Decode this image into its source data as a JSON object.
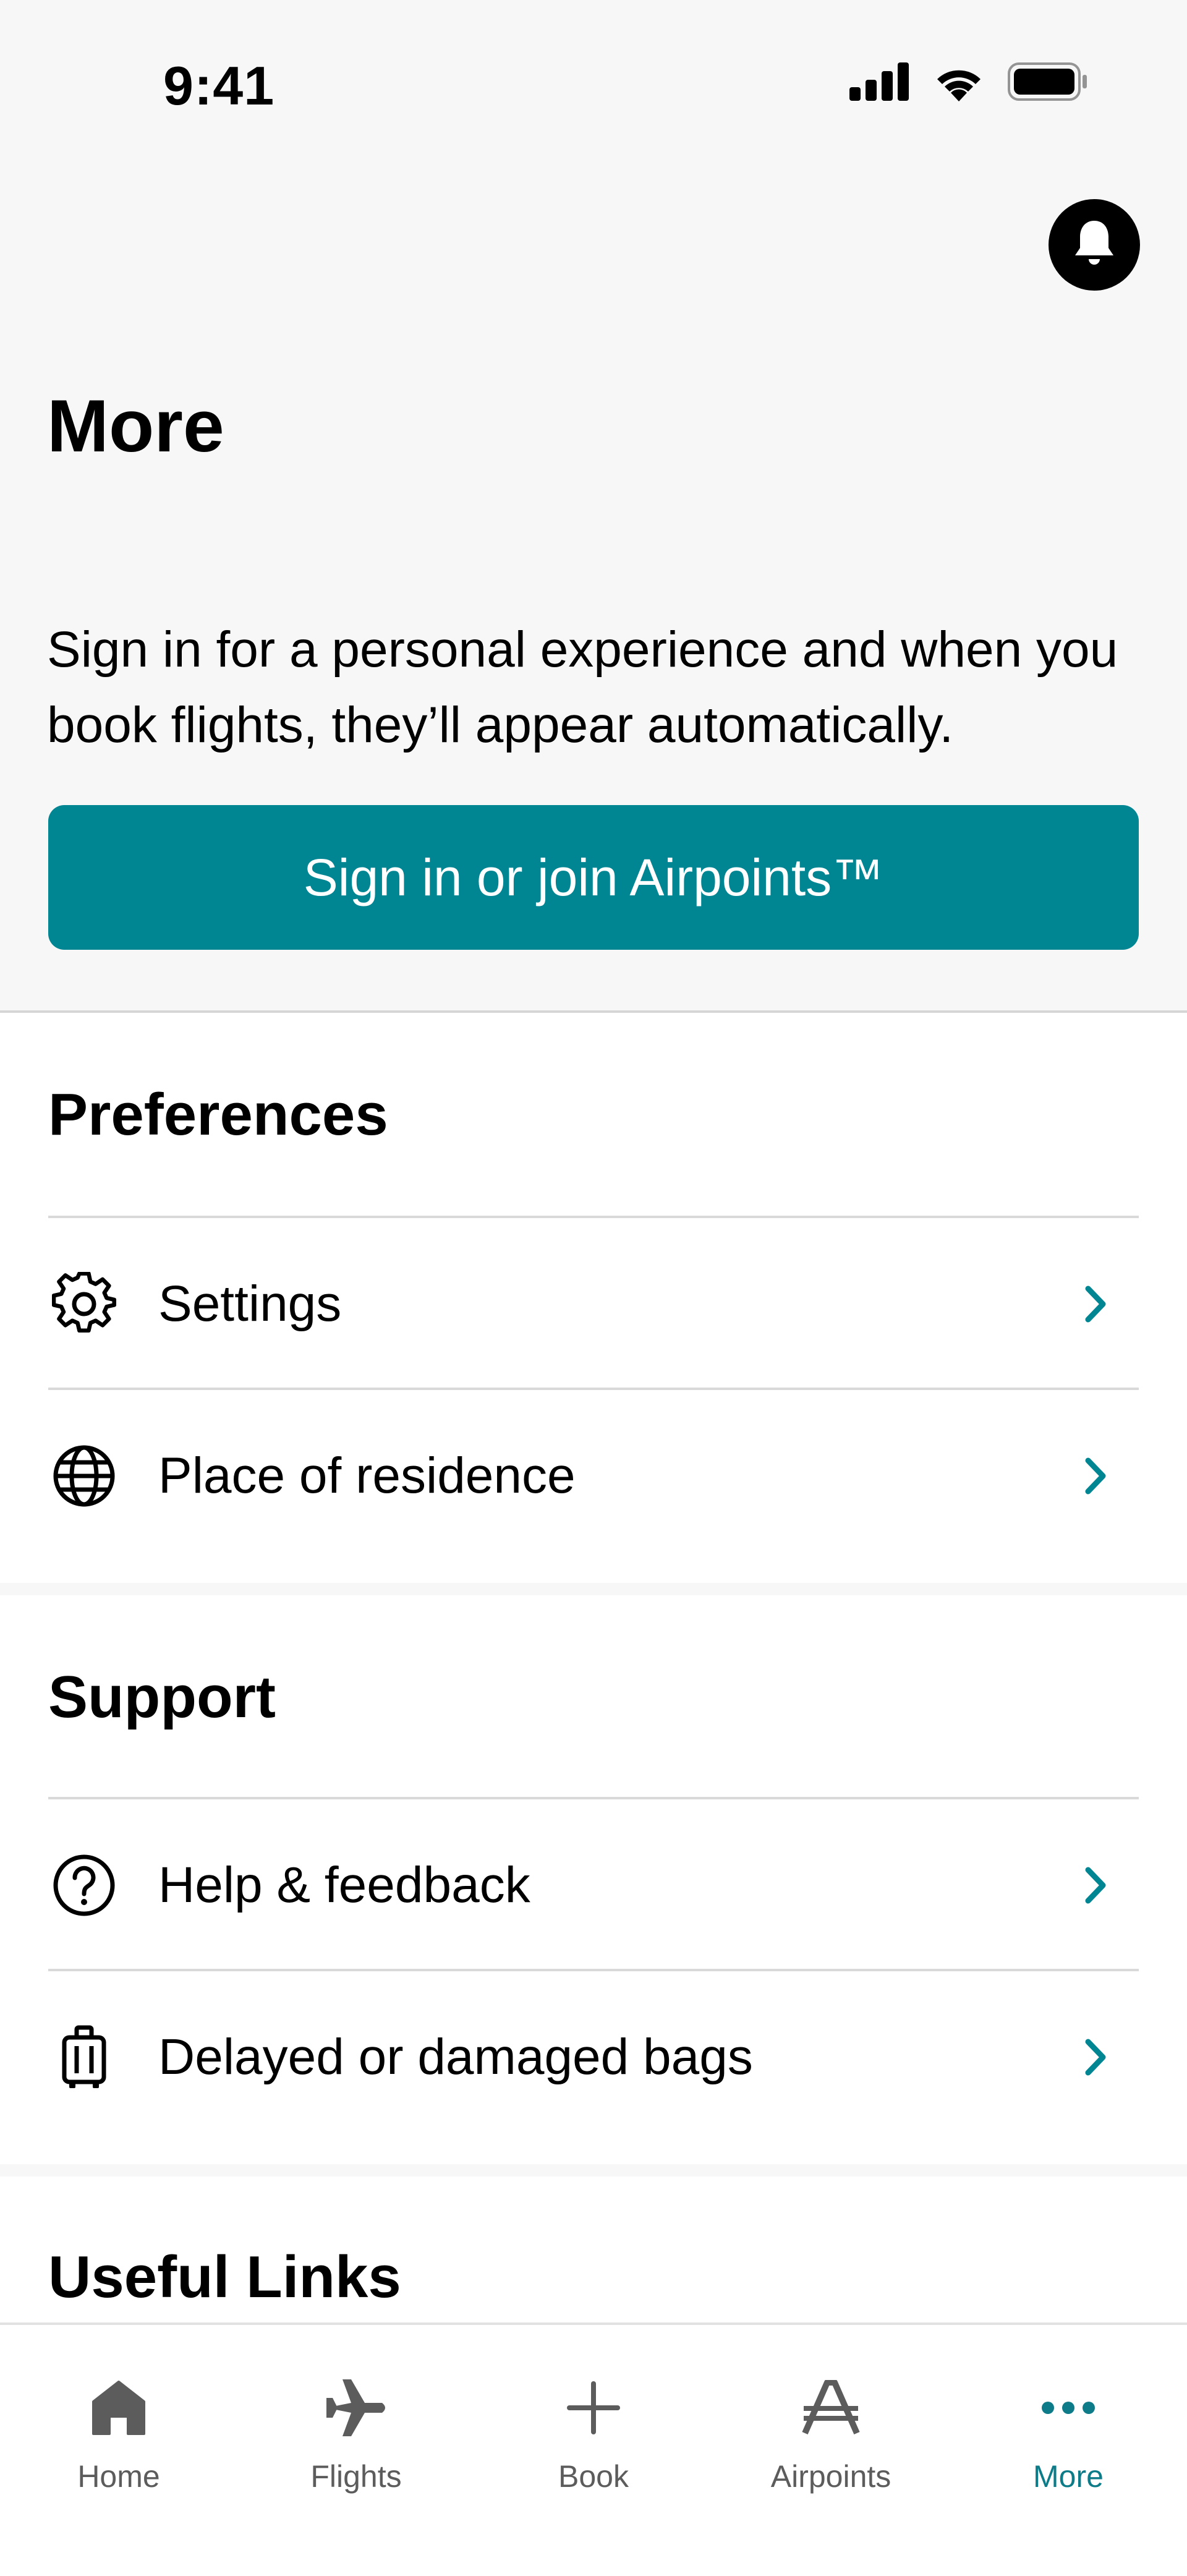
{
  "status_bar": {
    "time": "9:41",
    "icons": [
      "signal-icon",
      "wifi-icon",
      "battery-icon"
    ]
  },
  "header": {
    "notification_icon": "bell-icon",
    "title": "More"
  },
  "intro": {
    "text": "Sign in for a personal experience and when you book flights, they’ll appear automatically."
  },
  "signin_button": {
    "label": "Sign in or join Airpoints™"
  },
  "sections": {
    "preferences": {
      "title": "Preferences",
      "items": [
        {
          "label": "Settings",
          "icon": "gear-icon"
        },
        {
          "label": "Place of residence",
          "icon": "globe-icon"
        }
      ]
    },
    "support": {
      "title": "Support",
      "items": [
        {
          "label": "Help & feedback",
          "icon": "question-circle-icon"
        },
        {
          "label": "Delayed or damaged bags",
          "icon": "luggage-icon"
        }
      ]
    },
    "useful_links": {
      "title": "Useful Links"
    }
  },
  "tab_bar": {
    "tabs": [
      {
        "label": "Home",
        "icon": "home-icon"
      },
      {
        "label": "Flights",
        "icon": "plane-icon"
      },
      {
        "label": "Book",
        "icon": "plus-icon"
      },
      {
        "label": "Airpoints",
        "icon": "airpoints-icon"
      },
      {
        "label": "More",
        "icon": "more-dots-icon",
        "active": true
      }
    ]
  },
  "colors": {
    "accent": "#008593",
    "active_tab": "#0d7b88",
    "inactive_tab": "#5c5c5c",
    "background": "#f7f7f7",
    "card": "#ffffff"
  }
}
